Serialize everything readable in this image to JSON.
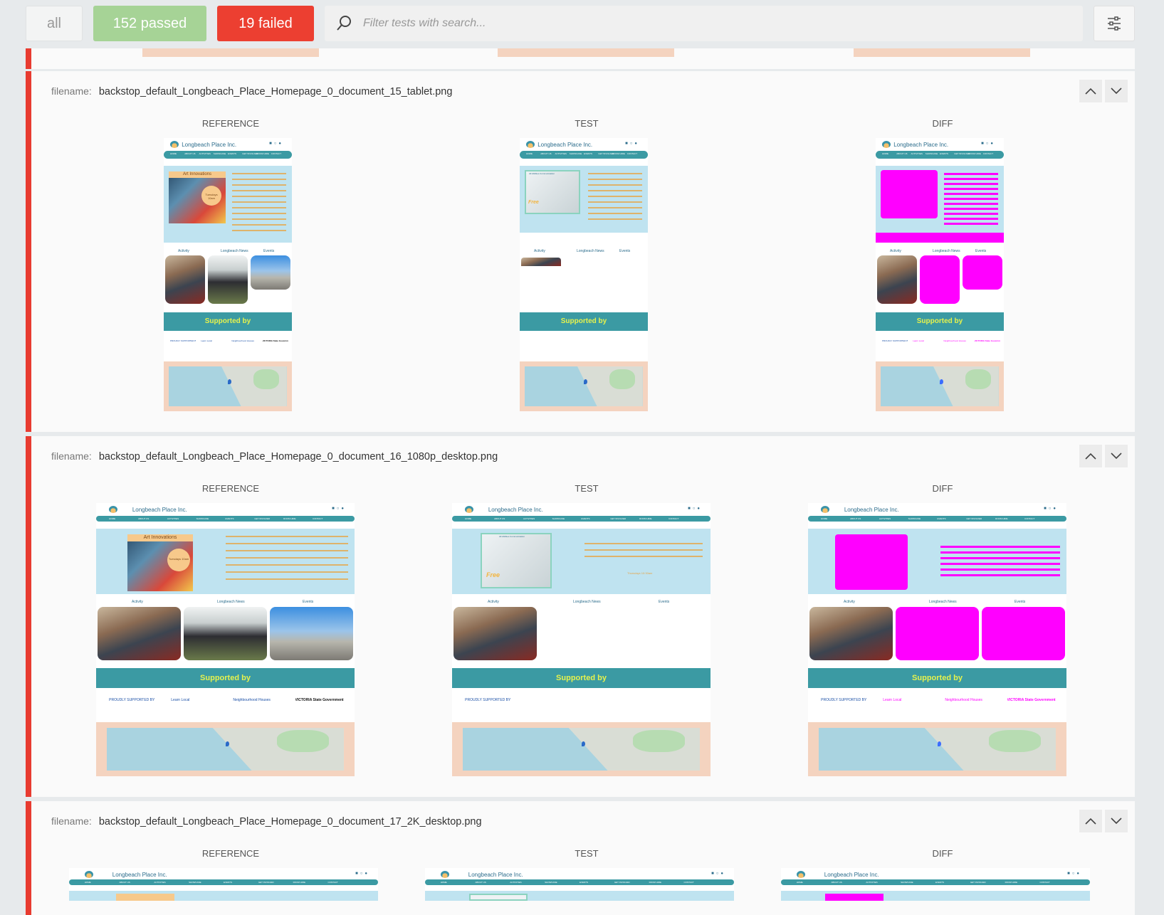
{
  "toolbar": {
    "all_label": "all",
    "passed_label": "152 passed",
    "failed_label": "19 failed",
    "search_placeholder": "Filter tests with search..."
  },
  "labels": {
    "filename": "filename:",
    "reference": "REFERENCE",
    "test": "TEST",
    "diff": "DIFF"
  },
  "tests": [
    {
      "filename": "backstop_default_Longbeach_Place_Homepage_0_document_15_tablet.png"
    },
    {
      "filename": "backstop_default_Longbeach_Place_Homepage_0_document_16_1080p_desktop.png"
    },
    {
      "filename": "backstop_default_Longbeach_Place_Homepage_0_document_17_2K_desktop.png"
    }
  ],
  "site": {
    "title": "Longbeach Place Inc.",
    "nav": [
      "HOME",
      "ABOUT US",
      "ACTIVITIES",
      "SHOWCASE",
      "EVENTS",
      "GET INVOLVED",
      "ROOM HIRE",
      "CONTACT"
    ],
    "hero_card_ref": "Art Innovations",
    "hero_badge_ref": "Tuesdays 10am",
    "hero_card_test": "All Abilities Communication",
    "free_label": "Free",
    "tabs": [
      "Activity",
      "Longbeach News",
      "Events"
    ],
    "supported_by": "Supported by",
    "hours_test": "Thursdays 10:30am",
    "logos": [
      "PROUDLY SUPPORTED BY",
      "Learn Local",
      "Neighbourhood Houses",
      "VICTORIA State Government"
    ]
  },
  "colors": {
    "failed": "#ec3f31",
    "passed": "#a6d396",
    "diff": "#ff00ff",
    "teal": "#3b9aa3"
  }
}
